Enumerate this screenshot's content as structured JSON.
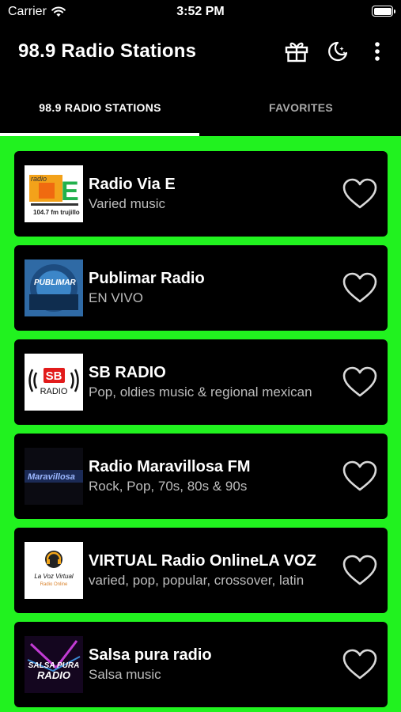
{
  "status": {
    "carrier": "Carrier",
    "time": "3:52 PM"
  },
  "header": {
    "title": "98.9 Radio Stations",
    "actions": [
      "gift-icon",
      "moon-stars-icon",
      "more-vertical-icon"
    ]
  },
  "tabs": [
    {
      "label": "98.9 RADIO STATIONS",
      "active": true
    },
    {
      "label": "FAVORITES",
      "active": false
    }
  ],
  "colors": {
    "accent": "#21f21f",
    "background": "#000000",
    "card": "#000000"
  },
  "stations": [
    {
      "name": "Radio Via E",
      "desc": "Varied music",
      "logo": {
        "lines": [
          "radio",
          "E",
          "104.7 fm trujillo"
        ]
      }
    },
    {
      "name": "Publimar Radio",
      "desc": "EN VIVO",
      "logo": {
        "lines": [
          "PUBLIMAR"
        ]
      }
    },
    {
      "name": "SB RADIO",
      "desc": "Pop, oldies music & regional mexican",
      "logo": {
        "lines": [
          "SB",
          "RADIO"
        ]
      }
    },
    {
      "name": "Radio Maravillosa FM",
      "desc": "Rock, Pop, 70s, 80s & 90s",
      "logo": {
        "lines": [
          "Maravillosa"
        ]
      }
    },
    {
      "name": "VIRTUAL Radio OnlineLA VOZ",
      "desc": "varied, pop, popular, crossover, latin",
      "logo": {
        "lines": [
          "La Voz Virtual",
          "Radio Online"
        ]
      }
    },
    {
      "name": "Salsa pura radio",
      "desc": "Salsa music",
      "logo": {
        "lines": [
          "SALSA PURA",
          "RADIO"
        ]
      }
    }
  ]
}
